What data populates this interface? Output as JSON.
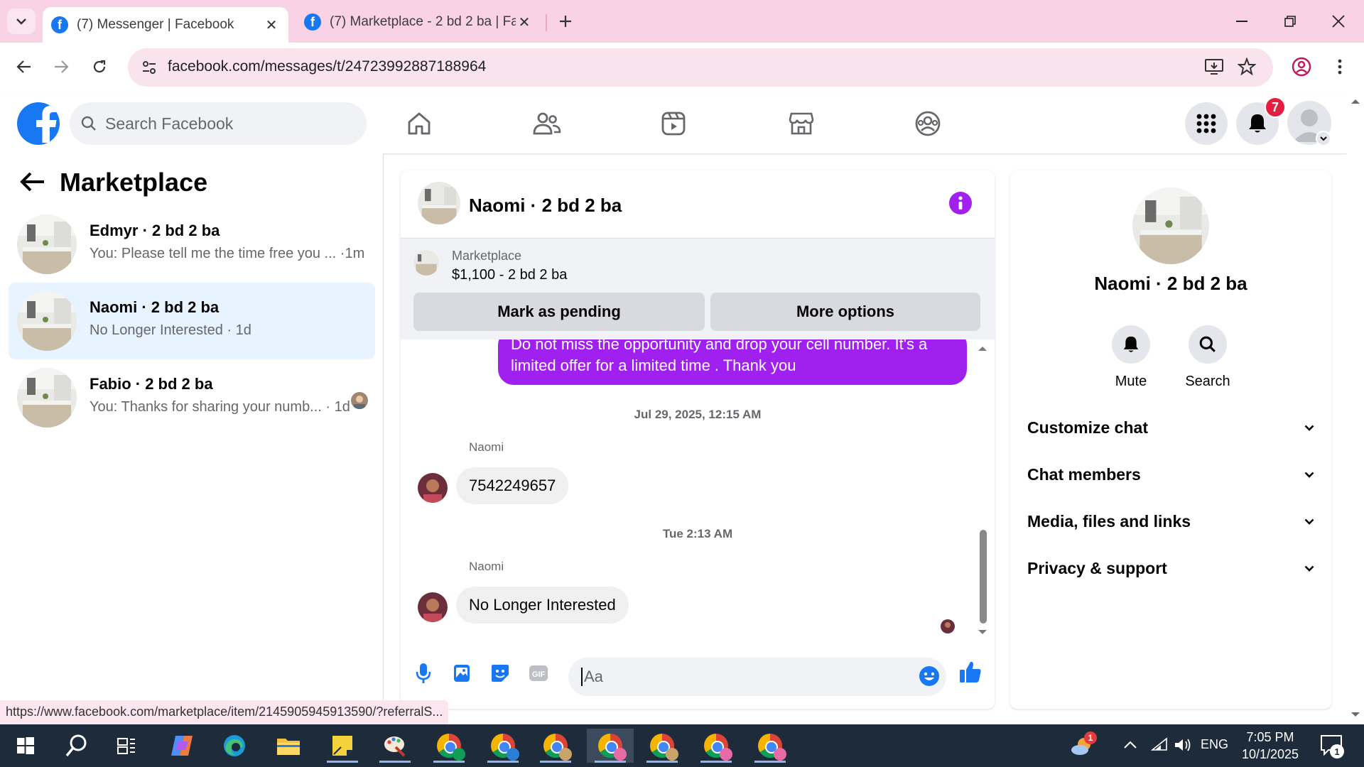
{
  "browser": {
    "tabs": [
      {
        "title": "(7) Messenger | Facebook",
        "active": true
      },
      {
        "title": "(7) Marketplace - 2 bd 2 ba | Fa",
        "active": false
      }
    ],
    "url": "facebook.com/messages/t/24723992887188964"
  },
  "fb": {
    "search_placeholder": "Search Facebook",
    "notifications_count": "7"
  },
  "left": {
    "title": "Marketplace",
    "conversations": [
      {
        "name": "Edmyr · 2 bd 2 ba",
        "preview": "You: Please tell me the time free you ... ·1m"
      },
      {
        "name": "Naomi · 2 bd 2 ba",
        "preview": "No Longer Interested · 1d"
      },
      {
        "name": "Fabio · 2 bd 2 ba",
        "preview": "You: Thanks for sharing your numb... · 1d"
      }
    ]
  },
  "chat": {
    "title": "Naomi · 2 bd 2 ba",
    "marketplace_label": "Marketplace",
    "listing": "$1,100 - 2 bd 2 ba",
    "mark_pending": "Mark as pending",
    "more_options": "More options",
    "outgoing_text": "Do not miss the opportunity and drop your cell number. It's a limited offer for a limited time . Thank you",
    "timestamp1": "Jul 29, 2025, 12:15 AM",
    "sender": "Naomi",
    "msg1": "7542249657",
    "timestamp2": "Tue 2:13 AM",
    "msg2": "No Longer Interested",
    "input_placeholder": "Aa"
  },
  "info": {
    "name": "Naomi · 2 bd 2 ba",
    "mute": "Mute",
    "search": "Search",
    "sections": [
      "Customize chat",
      "Chat members",
      "Media, files and links",
      "Privacy & support"
    ]
  },
  "status_link": "https://www.facebook.com/marketplace/item/2145905945913590/?referralS...",
  "taskbar": {
    "lang": "ENG",
    "time": "7:05 PM",
    "date": "10/1/2025",
    "notif_count": "1"
  },
  "colors": {
    "fb_blue": "#1877f2",
    "messenger_purple": "#a020f0",
    "selected_row": "#e7f3ff",
    "tabstrip": "#f9d2e6"
  }
}
